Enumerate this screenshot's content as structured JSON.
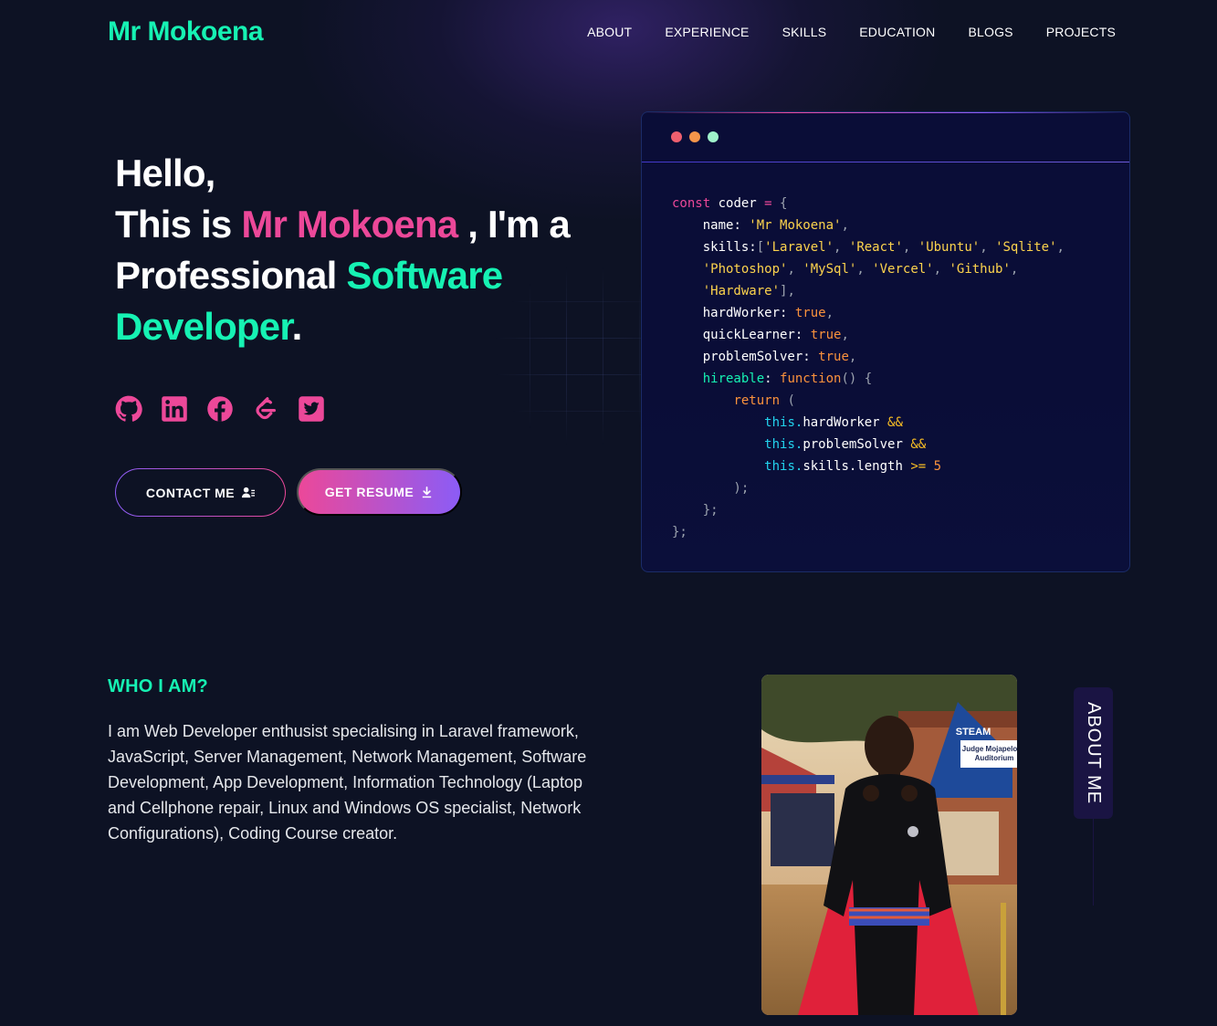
{
  "nav": {
    "brand": "Mr Mokoena",
    "links": [
      "ABOUT",
      "EXPERIENCE",
      "SKILLS",
      "EDUCATION",
      "BLOGS",
      "PROJECTS"
    ]
  },
  "hero": {
    "line1": "Hello,",
    "line2_prefix": "This is ",
    "name": "Mr Mokoena",
    "line2_suffix": " , I'm a",
    "line3_prefix": "Professional ",
    "role_word1": "Software",
    "role_word2": "Developer",
    "period": ".",
    "socials": [
      "github-icon",
      "linkedin-icon",
      "facebook-icon",
      "leetcode-icon",
      "twitter-icon"
    ],
    "contact_label": "CONTACT ME",
    "resume_label": "GET RESUME"
  },
  "code_card": {
    "dot_colors": [
      "#ef5f6f",
      "#f5954a",
      "#9ff2cb"
    ],
    "lines": [
      [
        [
          "const",
          "c-pink"
        ],
        [
          " coder ",
          ""
        ],
        [
          "=",
          "c-pink"
        ],
        [
          " {",
          "c-gray"
        ]
      ],
      [
        [
          "    name",
          ""
        ],
        [
          ":",
          ""
        ],
        [
          " 'Mr Mokoena'",
          "c-yellow"
        ],
        [
          ",",
          "c-gray"
        ]
      ],
      [
        [
          "    skills",
          ""
        ],
        [
          ":",
          ""
        ],
        [
          "[",
          "c-gray"
        ],
        [
          "'Laravel'",
          "c-yellow"
        ],
        [
          ", ",
          "c-gray"
        ],
        [
          "'React'",
          "c-yellow"
        ],
        [
          ", ",
          "c-gray"
        ],
        [
          "'Ubuntu'",
          "c-yellow"
        ],
        [
          ", ",
          "c-gray"
        ],
        [
          "'Sqlite'",
          "c-yellow"
        ],
        [
          ",",
          "c-gray"
        ]
      ],
      [
        [
          "    ",
          ""
        ],
        [
          "'Photoshop'",
          "c-yellow"
        ],
        [
          ", ",
          "c-gray"
        ],
        [
          "'MySql'",
          "c-yellow"
        ],
        [
          ", ",
          "c-gray"
        ],
        [
          "'Vercel'",
          "c-yellow"
        ],
        [
          ", ",
          "c-gray"
        ],
        [
          "'Github'",
          "c-yellow"
        ],
        [
          ",",
          "c-gray"
        ]
      ],
      [
        [
          "    ",
          ""
        ],
        [
          "'Hardware'",
          "c-yellow"
        ],
        [
          "],",
          "c-gray"
        ]
      ],
      [
        [
          "    hardWorker",
          ""
        ],
        [
          ":",
          ""
        ],
        [
          " true",
          "c-orange"
        ],
        [
          ",",
          "c-gray"
        ]
      ],
      [
        [
          "    quickLearner",
          ""
        ],
        [
          ":",
          ""
        ],
        [
          " true",
          "c-orange"
        ],
        [
          ",",
          "c-gray"
        ]
      ],
      [
        [
          "    problemSolver",
          ""
        ],
        [
          ":",
          ""
        ],
        [
          " true",
          "c-orange"
        ],
        [
          ",",
          "c-gray"
        ]
      ],
      [
        [
          "    hireable",
          "c-green"
        ],
        [
          ":",
          ""
        ],
        [
          " function",
          "c-orange"
        ],
        [
          "() {",
          "c-gray"
        ]
      ],
      [
        [
          "        ",
          ""
        ],
        [
          "return",
          "c-orange"
        ],
        [
          " (",
          "c-gray"
        ]
      ],
      [
        [
          "            ",
          ""
        ],
        [
          "this.",
          "c-cyan"
        ],
        [
          "hardWorker",
          ""
        ],
        [
          " &&",
          "c-amber"
        ]
      ],
      [
        [
          "            ",
          ""
        ],
        [
          "this.",
          "c-cyan"
        ],
        [
          "problemSolver",
          ""
        ],
        [
          " &&",
          "c-amber"
        ]
      ],
      [
        [
          "            ",
          ""
        ],
        [
          "this.",
          "c-cyan"
        ],
        [
          "skills.length",
          ""
        ],
        [
          " >=",
          "c-amber"
        ],
        [
          " 5",
          "c-orange"
        ]
      ],
      [
        [
          "        );",
          "c-gray"
        ]
      ],
      [
        [
          "    };",
          "c-gray"
        ]
      ],
      [
        [
          "};",
          "c-gray"
        ]
      ]
    ]
  },
  "about": {
    "heading": "WHO I AM?",
    "text": "I am Web Developer enthusist specialising in Laravel framework, JavaScript, Server Management, Network Management, Software Development, App Development, Information Technology (Laptop and Cellphone repair, Linux and Windows OS specialist, Network Configurations), Coding Course creator.",
    "tab_label": "ABOUT ME",
    "sign_line1": "STEAM",
    "sign_line2": "Judge Mojapelo",
    "sign_line3": "Auditorium"
  },
  "colors": {
    "accent_green": "#16f2b3",
    "accent_pink": "#ec4899",
    "accent_purple": "#8b5cf6",
    "background": "#0d1224"
  }
}
